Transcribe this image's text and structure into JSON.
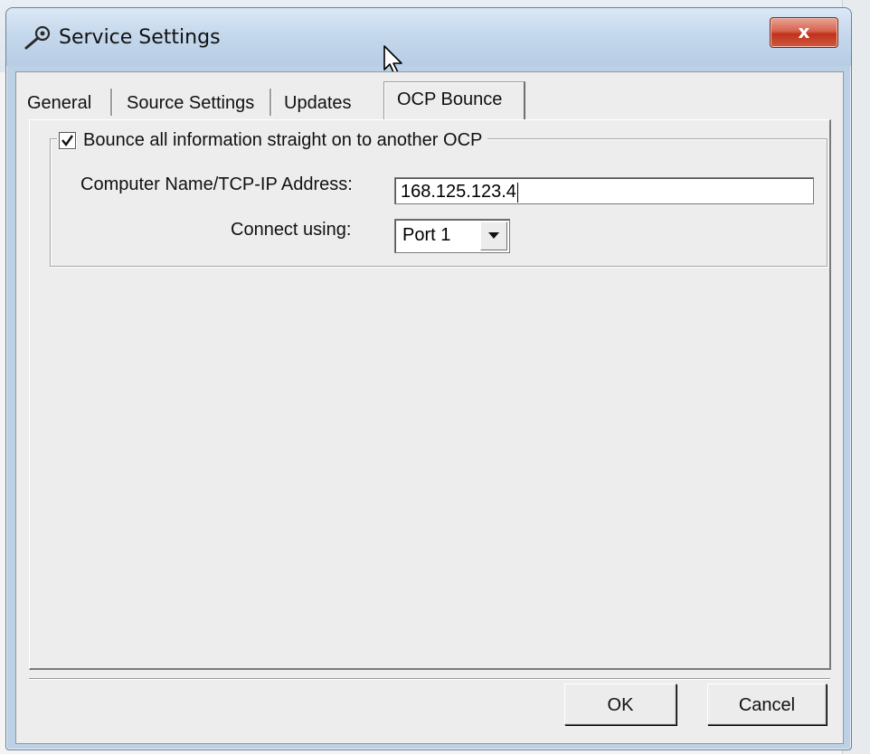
{
  "window": {
    "title": "Service Settings",
    "close_label": "x"
  },
  "tabs": [
    {
      "label": "General",
      "active": false
    },
    {
      "label": "Source Settings",
      "active": false
    },
    {
      "label": "Updates",
      "active": false
    },
    {
      "label": "OCP Bounce",
      "active": true
    }
  ],
  "ocp_bounce": {
    "bounce_checkbox_label": "Bounce all information straight on to another OCP",
    "bounce_checked": true,
    "computer_name_label": "Computer Name/TCP-IP Address:",
    "computer_name_value": "168.125.123.4",
    "connect_using_label": "Connect using:",
    "connect_using_value": "Port 1"
  },
  "buttons": {
    "ok_label": "OK",
    "cancel_label": "Cancel"
  },
  "icons": {
    "title_icon": "wrench-icon",
    "cursor": "mouse-pointer-icon",
    "dropdown": "chevron-down-icon"
  },
  "colors": {
    "close_button": "#c0321c",
    "titlebar": "#c5d8ec"
  }
}
